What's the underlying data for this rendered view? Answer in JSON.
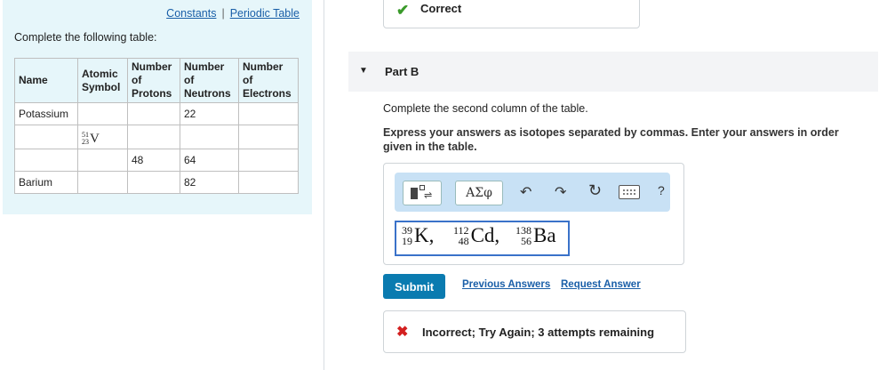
{
  "links": {
    "constants": "Constants",
    "separator": "|",
    "periodic_table": "Periodic Table"
  },
  "instruction": "Complete the following table:",
  "table": {
    "headers": {
      "name": "Name",
      "symbol": [
        "Atomic",
        "Symbol"
      ],
      "protons": [
        "Number",
        "of",
        "Protons"
      ],
      "neutrons": [
        "Number",
        "of",
        "Neutrons"
      ],
      "electrons": [
        "Number",
        "of",
        "Electrons"
      ]
    },
    "rows": [
      {
        "name": "Potassium",
        "symbol": null,
        "protons": "",
        "neutrons": "22",
        "electrons": ""
      },
      {
        "name": "",
        "symbol": {
          "mass": "51",
          "atomic": "23",
          "element": "V"
        },
        "protons": "",
        "neutrons": "",
        "electrons": ""
      },
      {
        "name": "",
        "symbol": null,
        "protons": "48",
        "neutrons": "64",
        "electrons": ""
      },
      {
        "name": "Barium",
        "symbol": null,
        "protons": "",
        "neutrons": "82",
        "electrons": ""
      }
    ]
  },
  "previous_part": {
    "status": "Correct",
    "icon": "check-icon"
  },
  "part_b": {
    "title": "Part B",
    "question": "Complete the second column of the table.",
    "hint": "Express your answers as isotopes separated by commas. Enter your answers in order given in the table.",
    "toolbar": {
      "greek": "ΑΣφ",
      "help": "?"
    },
    "answer": [
      {
        "mass": "39",
        "atomic": "19",
        "element": "K",
        "sep": ","
      },
      {
        "mass": "112",
        "atomic": "48",
        "element": "Cd",
        "sep": ","
      },
      {
        "mass": "138",
        "atomic": "56",
        "element": "Ba",
        "sep": ""
      }
    ],
    "submit": "Submit",
    "previous_answers": "Previous Answers",
    "request_answer": "Request Answer",
    "feedback": "Incorrect; Try Again; 3 attempts remaining"
  },
  "colors": {
    "accent": "#0a7bb0",
    "link": "#1a5fa8",
    "correct": "#3a9a2a",
    "incorrect": "#d32020",
    "panel": "#e6f6fa"
  }
}
